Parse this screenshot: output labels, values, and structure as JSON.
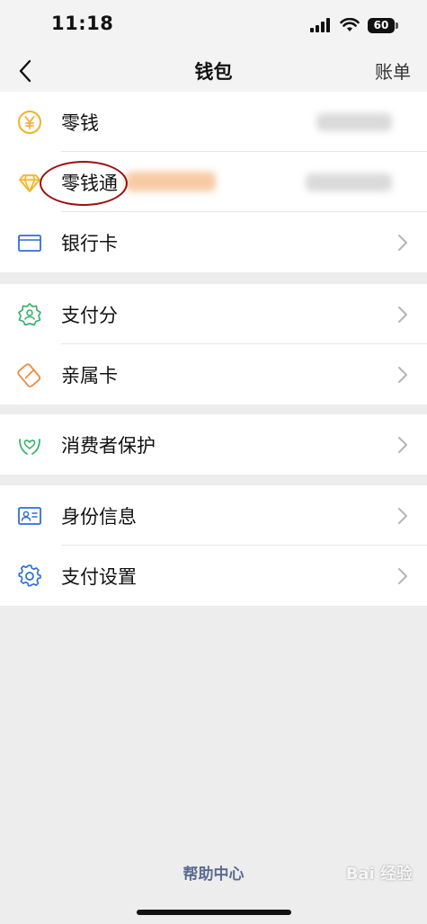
{
  "status": {
    "time": "11:18",
    "battery": "60"
  },
  "nav": {
    "title": "钱包",
    "right_label": "账单"
  },
  "groups": [
    {
      "items": [
        {
          "label": "零钱"
        },
        {
          "label": "零钱通"
        },
        {
          "label": "银行卡"
        }
      ]
    },
    {
      "items": [
        {
          "label": "支付分"
        },
        {
          "label": "亲属卡"
        }
      ]
    },
    {
      "items": [
        {
          "label": "消费者保护"
        }
      ]
    },
    {
      "items": [
        {
          "label": "身份信息"
        },
        {
          "label": "支付设置"
        }
      ]
    }
  ],
  "footer": {
    "help_label": "帮助中心"
  },
  "watermark": "Bai 经验",
  "colors": {
    "accent_yellow": "#f0b429",
    "accent_green": "#3bb36b",
    "accent_blue": "#2f6fd6",
    "accent_orange": "#f08a3a",
    "link": "#5b6b92"
  }
}
